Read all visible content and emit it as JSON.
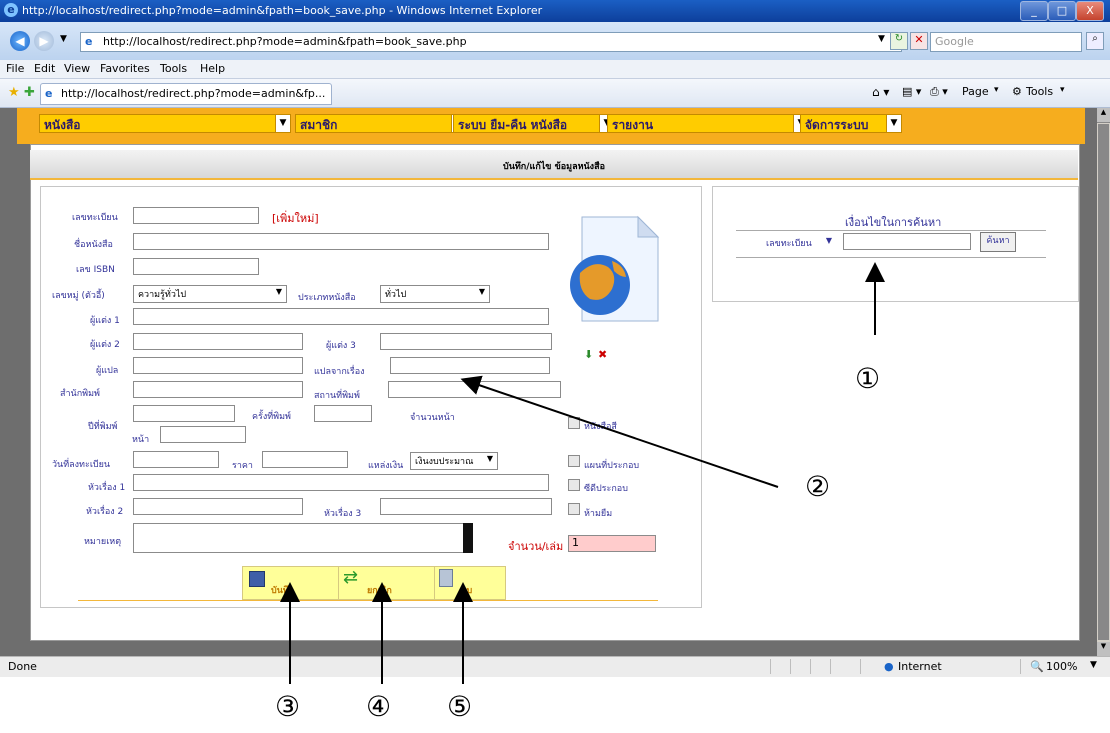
{
  "window": {
    "title": "http://localhost/redirect.php?mode=admin&fpath=book_save.php - Windows Internet Explorer",
    "controls": [
      "_",
      "□",
      "X"
    ]
  },
  "browser": {
    "address": "http://localhost/redirect.php?mode=admin&fpath=book_save.php",
    "search_placeholder": "Google",
    "menu": [
      "File",
      "Edit",
      "View",
      "Favorites",
      "Tools",
      "Help"
    ],
    "tab_title": "http://localhost/redirect.php?mode=admin&fp...",
    "cmd_page": "Page",
    "cmd_tools": "Tools"
  },
  "nav_menu": [
    {
      "label": "หนังสือ"
    },
    {
      "label": "สมาชิก"
    },
    {
      "label": "ระบบ ยืม-คืน หนังสือ"
    },
    {
      "label": "รายงาน"
    },
    {
      "label": "จัดการระบบ"
    }
  ],
  "form": {
    "title": "บันทึก/แก้ไข ข้อมูลหนังสือ",
    "labels": {
      "reg_no": "เลขทะเบียน",
      "new_tag": "[เพิ่มใหม่]",
      "book_name": "ชื่อหนังสือ",
      "isbn": "เลข ISBN",
      "call_no": "เลขหมู่ (ตัวอี้)",
      "book_type": "ประเภทหนังสือ",
      "author1": "ผู้แต่ง 1",
      "author2": "ผู้แต่ง 2",
      "author3": "ผู้แต่ง 3",
      "translator": "ผู้แปล",
      "translated_from": "แปลจากเรื่อง",
      "publisher": "สำนักพิมพ์",
      "publish_place": "สถานที่พิมพ์",
      "publish_year": "ปีที่พิมพ์",
      "edition": "ครั้งที่พิมพ์",
      "pages": "จำนวนหน้า",
      "page_unit": "หน้า",
      "reg_date": "วันที่ลงทะเบียน",
      "price": "ราคา",
      "fund_source": "แหล่งเงิน",
      "subject1": "หัวเรื่อง 1",
      "subject2": "หัวเรื่อง 2",
      "subject3": "หัวเรื่อง 3",
      "note": "หมายเหตุ",
      "copies": "จำนวน/เล่ม"
    },
    "values": {
      "call_no": "ความรู้ทั่วไป",
      "book_type": "ทั่วไป",
      "fund_source": "เงินงบประมาณ",
      "copies": "1"
    },
    "checkboxes": [
      "หนังสือสี",
      "แผนที่ประกอบ",
      "ซีดีประกอบ",
      "ห้ามยืม"
    ],
    "buttons": {
      "save": "บันทึก",
      "cancel": "ยกเลิก",
      "delete": "ลบ"
    }
  },
  "search_panel": {
    "title": "เงื่อนไขในการค้นหา",
    "field": "เลขทะเบียน",
    "button": "ค้นหา"
  },
  "callouts": [
    "①",
    "②",
    "③",
    "④",
    "⑤"
  ],
  "status": {
    "left": "Done",
    "zone": "Internet",
    "zoom": "100%"
  },
  "colors": {
    "nav_bar": "#f6ad1e",
    "nav_dropdown": "#ffcc00",
    "button_bg": "#ffff99",
    "copies_bg": "#ffcccc",
    "label": "#333399",
    "new_tag": "#cc0000"
  }
}
